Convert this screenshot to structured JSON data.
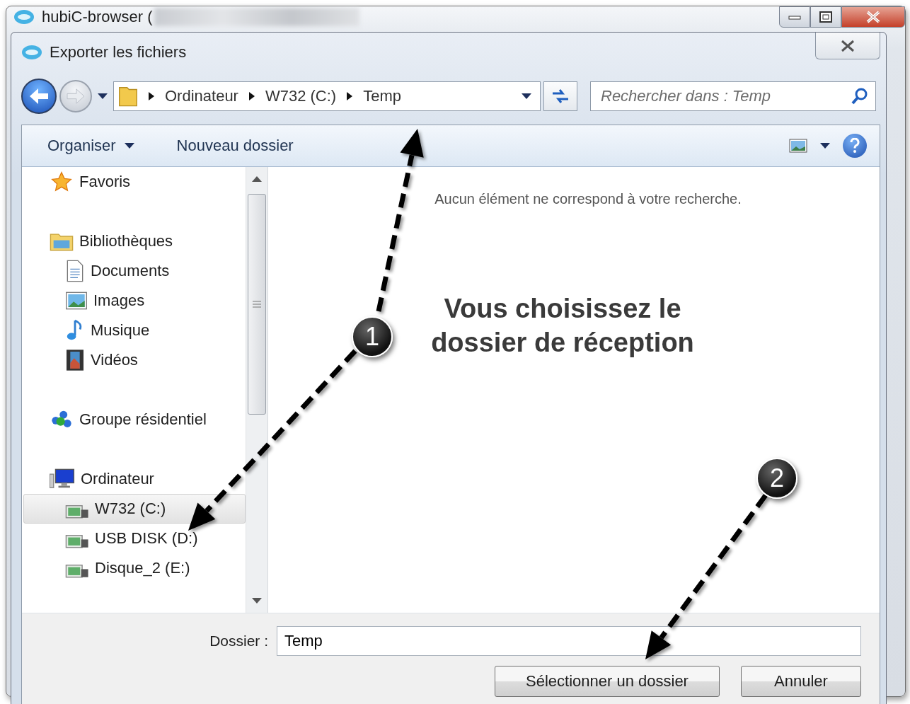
{
  "app_window": {
    "title": "hubiC-browser (",
    "title_obscured": true
  },
  "dialog": {
    "title": "Exporter les fichiers"
  },
  "address_bar": {
    "crumbs": [
      "Ordinateur",
      "W732 (C:)",
      "Temp"
    ]
  },
  "search": {
    "placeholder": "Rechercher dans : Temp"
  },
  "toolbar": {
    "organize": "Organiser",
    "new_folder": "Nouveau dossier"
  },
  "sidebar": {
    "groups": [
      {
        "label": "Favoris",
        "kind": "star",
        "selected": false
      },
      {
        "label": "Bibliothèques",
        "kind": "library",
        "selected": false,
        "children": [
          {
            "label": "Documents",
            "kind": "document",
            "selected": false
          },
          {
            "label": "Images",
            "kind": "picture",
            "selected": false
          },
          {
            "label": "Musique",
            "kind": "music",
            "selected": false
          },
          {
            "label": "Vidéos",
            "kind": "video",
            "selected": false
          }
        ]
      },
      {
        "label": "Groupe résidentiel",
        "kind": "homegroup",
        "selected": false
      },
      {
        "label": "Ordinateur",
        "kind": "computer",
        "selected": false,
        "children": [
          {
            "label": "W732 (C:)",
            "kind": "drive",
            "selected": true
          },
          {
            "label": "USB DISK (D:)",
            "kind": "drive",
            "selected": false
          },
          {
            "label": "Disque_2 (E:)",
            "kind": "drive",
            "selected": false
          }
        ]
      }
    ]
  },
  "content": {
    "empty_message": "Aucun élément ne correspond à votre recherche."
  },
  "footer": {
    "folder_label": "Dossier :",
    "folder_value": "Temp",
    "select_button": "Sélectionner un dossier",
    "cancel_button": "Annuler"
  },
  "annotations": {
    "callout": "Vous choisissez le dossier de réception",
    "steps": [
      "1",
      "2"
    ]
  }
}
